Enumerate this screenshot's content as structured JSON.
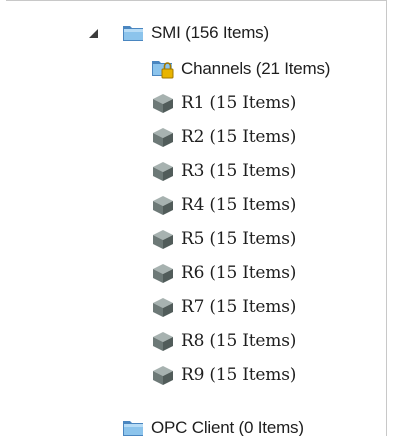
{
  "tree": {
    "root": {
      "label": "SMI (156 Items)",
      "icon": "folder-icon",
      "expanded": true,
      "children": [
        {
          "label": "Channels (21 Items)",
          "icon": "locked-folder-icon"
        },
        {
          "label": "R1 (15 Items)",
          "icon": "device-box-icon"
        },
        {
          "label": "R2 (15 Items)",
          "icon": "device-box-icon"
        },
        {
          "label": "R3 (15 Items)",
          "icon": "device-box-icon"
        },
        {
          "label": "R4 (15 Items)",
          "icon": "device-box-icon"
        },
        {
          "label": "R5 (15 Items)",
          "icon": "device-box-icon"
        },
        {
          "label": "R6 (15 Items)",
          "icon": "device-box-icon"
        },
        {
          "label": "R7 (15 Items)",
          "icon": "device-box-icon"
        },
        {
          "label": "R8 (15 Items)",
          "icon": "device-box-icon"
        },
        {
          "label": "R9 (15 Items)",
          "icon": "device-box-icon"
        }
      ]
    },
    "sibling": {
      "label": "OPC Client (0 Items)",
      "icon": "folder-icon"
    }
  },
  "colors": {
    "folder": "#8cc4ec",
    "folder_dark": "#4a86c0",
    "box_top": "#a7b2b0",
    "box_left": "#6d7977",
    "box_right": "#515c5a",
    "lock": "#e8b400",
    "text": "#1e1e1e"
  }
}
